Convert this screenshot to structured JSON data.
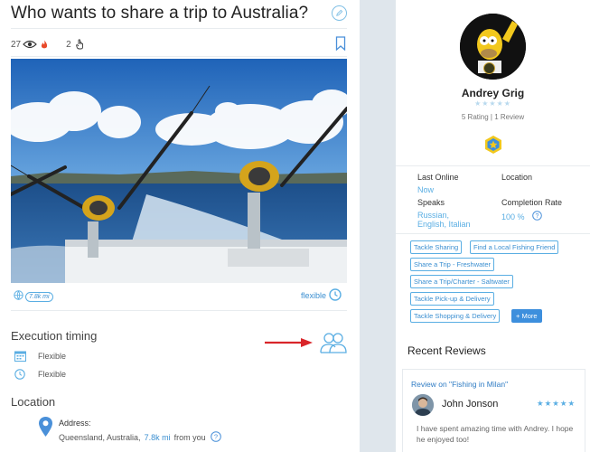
{
  "listing": {
    "title": "Who wants to share a trip to Australia?",
    "views": "27",
    "likes": "2",
    "distance_badge": "7.8k mi",
    "flexible_label": "flexible"
  },
  "execution": {
    "heading": "Execution timing",
    "date_value": "Flexible",
    "time_value": "Flexible"
  },
  "location": {
    "heading": "Location",
    "address_label": "Address:",
    "address_text": "Queensland, Australia,",
    "distance_link": "7.8k mi",
    "distance_suffix": "from you"
  },
  "profile": {
    "name": "Andrey Grig",
    "stars": "★★★★★",
    "rating_text": "5 Rating | 1 Review",
    "last_online_label": "Last Online",
    "last_online_value": "Now",
    "location_label": "Location",
    "speaks_label": "Speaks",
    "speaks_value_line1": "Russian,",
    "speaks_value_line2": "English, Italian",
    "completion_label": "Completion Rate",
    "completion_value": "100 %"
  },
  "tags": [
    "Tackle Sharing",
    "Find a Local Fishing Friend",
    "Share a Trip - Freshwater",
    "Share a Trip/Charter - Saltwater",
    "Tackle Pick-up & Delivery",
    "Tackle Shopping & Delivery"
  ],
  "tags_more": "+ More",
  "reviews": {
    "heading": "Recent Reviews",
    "item_title": "Review on \"Fishing in Milan\"",
    "reviewer": "John Jonson",
    "stars": "★★★★★",
    "text": "I have spent amazing time with Andrey. I hope he enjoyed too!"
  },
  "colors": {
    "accent": "#3b8fd1",
    "light_accent": "#5aaee3",
    "annotation_arrow": "#d9252a"
  }
}
